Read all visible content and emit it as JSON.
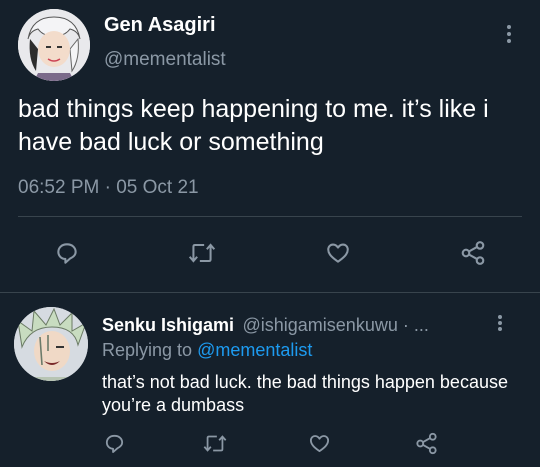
{
  "main_tweet": {
    "display_name": "Gen Asagiri",
    "handle": "@mementalist",
    "text": "bad things keep happening to me. it’s like i have bad luck or something",
    "timestamp": "06:52 PM · 05 Oct 21"
  },
  "reply": {
    "display_name": "Senku Ishigami",
    "handle_meta": "@ishigamisenkuwu · ...",
    "replying_prefix": "Replying to",
    "replying_to": "@mementalist",
    "text": "that’s not bad luck. the bad things happen because you’re a dumbass"
  },
  "icons": {
    "reply": "reply-icon",
    "retweet": "retweet-icon",
    "like": "like-icon",
    "share": "share-icon",
    "more": "more-icon"
  },
  "colors": {
    "background": "#15202b",
    "text": "#ffffff",
    "muted": "#8b98a5",
    "link": "#1d9bf0",
    "divider": "#38444d"
  }
}
